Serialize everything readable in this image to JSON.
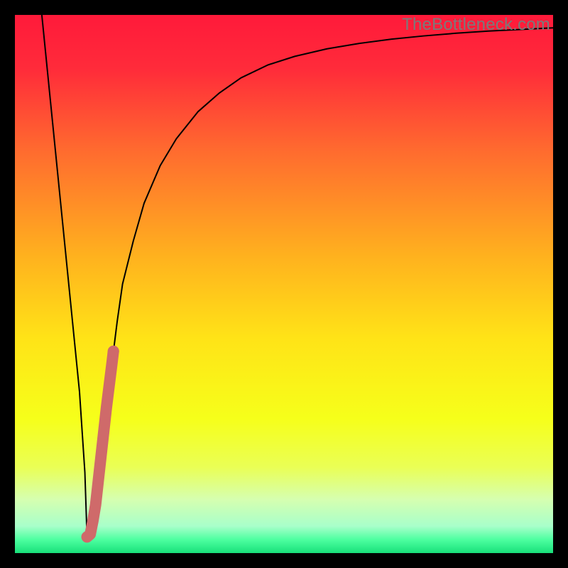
{
  "watermark": "TheBottleneck.com",
  "chart_data": {
    "type": "line",
    "title": "",
    "xlabel": "",
    "ylabel": "",
    "xlim": [
      0,
      100
    ],
    "ylim": [
      0,
      100
    ],
    "grid": false,
    "legend": false,
    "gradient_stops": [
      {
        "pos": 0.0,
        "color": "#ff1a3a"
      },
      {
        "pos": 0.1,
        "color": "#ff2b3a"
      },
      {
        "pos": 0.25,
        "color": "#ff6a2f"
      },
      {
        "pos": 0.45,
        "color": "#ffb21e"
      },
      {
        "pos": 0.6,
        "color": "#ffe317"
      },
      {
        "pos": 0.75,
        "color": "#f6ff1a"
      },
      {
        "pos": 0.84,
        "color": "#eaff55"
      },
      {
        "pos": 0.9,
        "color": "#d6ffb0"
      },
      {
        "pos": 0.95,
        "color": "#a8ffca"
      },
      {
        "pos": 0.975,
        "color": "#4dffa0"
      },
      {
        "pos": 1.0,
        "color": "#18e07a"
      }
    ],
    "series": [
      {
        "name": "bottleneck-curve",
        "stroke": "#000000",
        "x": [
          5,
          6,
          7,
          8,
          9,
          10,
          11,
          12,
          13,
          13.4,
          14,
          15,
          16,
          17,
          18,
          19,
          20,
          22,
          24,
          27,
          30,
          34,
          38,
          42,
          47,
          52,
          58,
          64,
          70,
          76,
          82,
          88,
          94,
          100
        ],
        "y": [
          100,
          90,
          80,
          70,
          60,
          50,
          40,
          30,
          15,
          3,
          3,
          9,
          18,
          27,
          35,
          43,
          50,
          58,
          65,
          72,
          77,
          82,
          85.5,
          88.3,
          90.7,
          92.3,
          93.7,
          94.7,
          95.5,
          96.1,
          96.6,
          97.0,
          97.3,
          97.6
        ]
      },
      {
        "name": "highlight-segment",
        "stroke": "#cf6a6a",
        "x": [
          13.4,
          14.0,
          14.5,
          15.0,
          15.5,
          16.0,
          16.5,
          17.0,
          17.5,
          18.0,
          18.3
        ],
        "y": [
          3.0,
          3.5,
          6.0,
          9.0,
          13.5,
          18.0,
          22.5,
          27.0,
          31.0,
          35.0,
          37.5
        ]
      }
    ]
  }
}
